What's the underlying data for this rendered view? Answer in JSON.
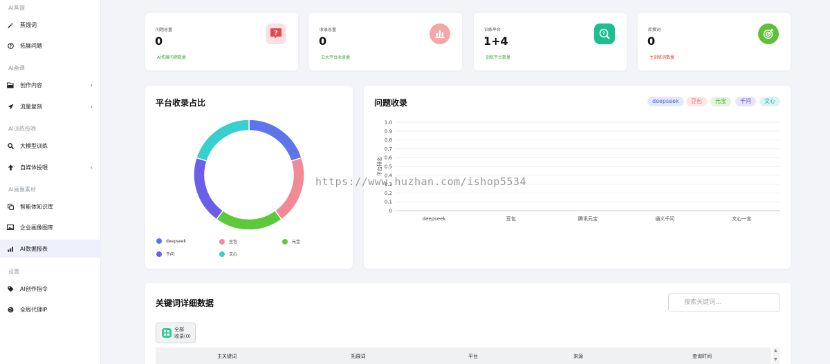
{
  "sidebar": {
    "groups": [
      {
        "title": "AI蒸馏",
        "items": [
          {
            "label": "蒸馏词",
            "icon": "magic-wand-icon"
          },
          {
            "label": "拓展问题",
            "icon": "question-circle-icon"
          }
        ]
      },
      {
        "title": "AI备课",
        "items": [
          {
            "label": "创作内容",
            "icon": "folder-open-icon"
          },
          {
            "label": "流量复刻",
            "icon": "paper-plane-icon"
          }
        ]
      },
      {
        "title": "AI训练投喂",
        "items": [
          {
            "label": "大模型训练",
            "icon": "search-icon"
          },
          {
            "label": "自媒体投喂",
            "icon": "arrow-up-icon"
          }
        ]
      },
      {
        "title": "AI画像素材",
        "items": [
          {
            "label": "智能体知识库",
            "icon": "copy-icon"
          },
          {
            "label": "企业画像图库",
            "icon": "image-icon"
          },
          {
            "label": "AI数据报表",
            "icon": "bar-chart-icon"
          }
        ]
      },
      {
        "title": "设置",
        "items": [
          {
            "label": "AI创作指令",
            "icon": "tag-icon"
          },
          {
            "label": "全局代理IP",
            "icon": "globe-icon"
          }
        ]
      }
    ],
    "collapse_caret": "‹"
  },
  "stats": [
    {
      "title": "问题总量",
      "value": "0",
      "sub": "AI拓展问题数量",
      "sub_color": "#3aaa3a",
      "icon": "question-chat-icon",
      "icon_bg": "#f9e1e4"
    },
    {
      "title": "收录总量",
      "value": "0",
      "sub": "五大平台收录量",
      "sub_color": "#3aaa3a",
      "icon": "bar-chart-icon",
      "icon_bg": "#f3a7a7"
    },
    {
      "title": "训练平台",
      "value": "1+4",
      "sub": "训练平台数量",
      "sub_color": "#3aaa3a",
      "icon": "search-help-icon",
      "icon_bg": "#1dbf91"
    },
    {
      "title": "库撰词",
      "value": "0",
      "sub": "主训练词数量",
      "sub_color": "#e03b3b",
      "icon": "target-icon",
      "icon_bg": "#5fc13a"
    }
  ],
  "donut": {
    "title": "平台收录占比",
    "legend": [
      {
        "name": "deepseek",
        "color": "#5f74ea"
      },
      {
        "name": "豆包",
        "color": "#f28a96"
      },
      {
        "name": "元宝",
        "color": "#5cc93a"
      },
      {
        "name": "千问",
        "color": "#6b5ee8"
      },
      {
        "name": "文心",
        "color": "#38cfcf"
      }
    ]
  },
  "chart_data": {
    "type": "bar",
    "title": "问题收录",
    "ylabel": "平台排名",
    "xlabel": "",
    "categories": [
      "deepseek",
      "豆包",
      "腾讯元宝",
      "通义千问",
      "文心一言"
    ],
    "values": [
      0,
      0,
      0,
      0,
      0
    ],
    "ylim": [
      0,
      1
    ],
    "yticks": [
      "1.0",
      "0.9",
      "0.8",
      "0.7",
      "0.6",
      "0.5",
      "0.4",
      "0.3",
      "0.2",
      "0.1",
      "0"
    ],
    "grid": true,
    "legend_tags": [
      {
        "name": "deepseek",
        "bg": "#e4e8fb",
        "color": "#4e63d9"
      },
      {
        "name": "豆包",
        "bg": "#fde6e8",
        "color": "#e0707f"
      },
      {
        "name": "元宝",
        "bg": "#e3f6dd",
        "color": "#4aa92c"
      },
      {
        "name": "千问",
        "bg": "#e8e5fb",
        "color": "#5a4ed8"
      },
      {
        "name": "文心",
        "bg": "#dcf5f4",
        "color": "#2aa8a8"
      }
    ]
  },
  "keywords": {
    "title": "关键词详细数据",
    "search_placeholder": "搜索关键词...",
    "filter_label_1": "全部",
    "filter_label_2": "收录(0)",
    "columns": [
      "主关键词",
      "拓展词",
      "平台",
      "来源",
      "查询时间"
    ]
  },
  "watermark": "https://www.huzhan.com/ishop5534"
}
